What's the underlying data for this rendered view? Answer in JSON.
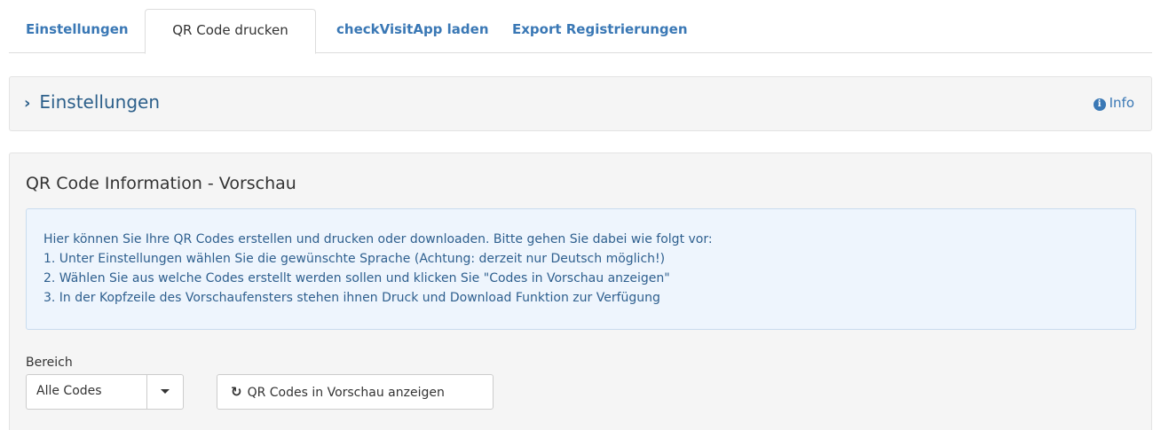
{
  "tabs": [
    {
      "label": "Einstellungen",
      "active": false
    },
    {
      "label": "QR Code drucken",
      "active": true
    },
    {
      "label": "checkVisitApp laden",
      "active": false
    },
    {
      "label": "Export Registrierungen",
      "active": false
    }
  ],
  "settings_panel": {
    "title": "Einstellungen",
    "toggle_icon": "chevron-right-icon",
    "info_icon": "info-circle-icon",
    "info_label": "Info"
  },
  "qr_panel": {
    "title": "QR Code Information - Vorschau",
    "alert_lines": [
      "Hier können Sie Ihre QR Codes erstellen und drucken oder downloaden. Bitte gehen Sie dabei wie folgt vor:",
      "1. Unter Einstellungen wählen Sie die gewünschte Sprache (Achtung: derzeit nur Deutsch möglich!)",
      "2. Wählen Sie aus welche Codes erstellt werden sollen und klicken Sie \"Codes in Vorschau anzeigen\"",
      "3. In der Kopfzeile des Vorschaufensters stehen ihnen Druck und Download Funktion zur Verfügung"
    ],
    "range_label": "Bereich",
    "range_selected": "Alle Codes",
    "preview_button_icon": "refresh-icon",
    "preview_button_label": "QR Codes in Vorschau anzeigen"
  },
  "colors": {
    "link": "#3a78b5",
    "panel_title": "#2c5f8a",
    "alert_bg": "#eef5fd",
    "alert_text": "#2e5f8e",
    "panel_bg": "#f5f5f5"
  }
}
